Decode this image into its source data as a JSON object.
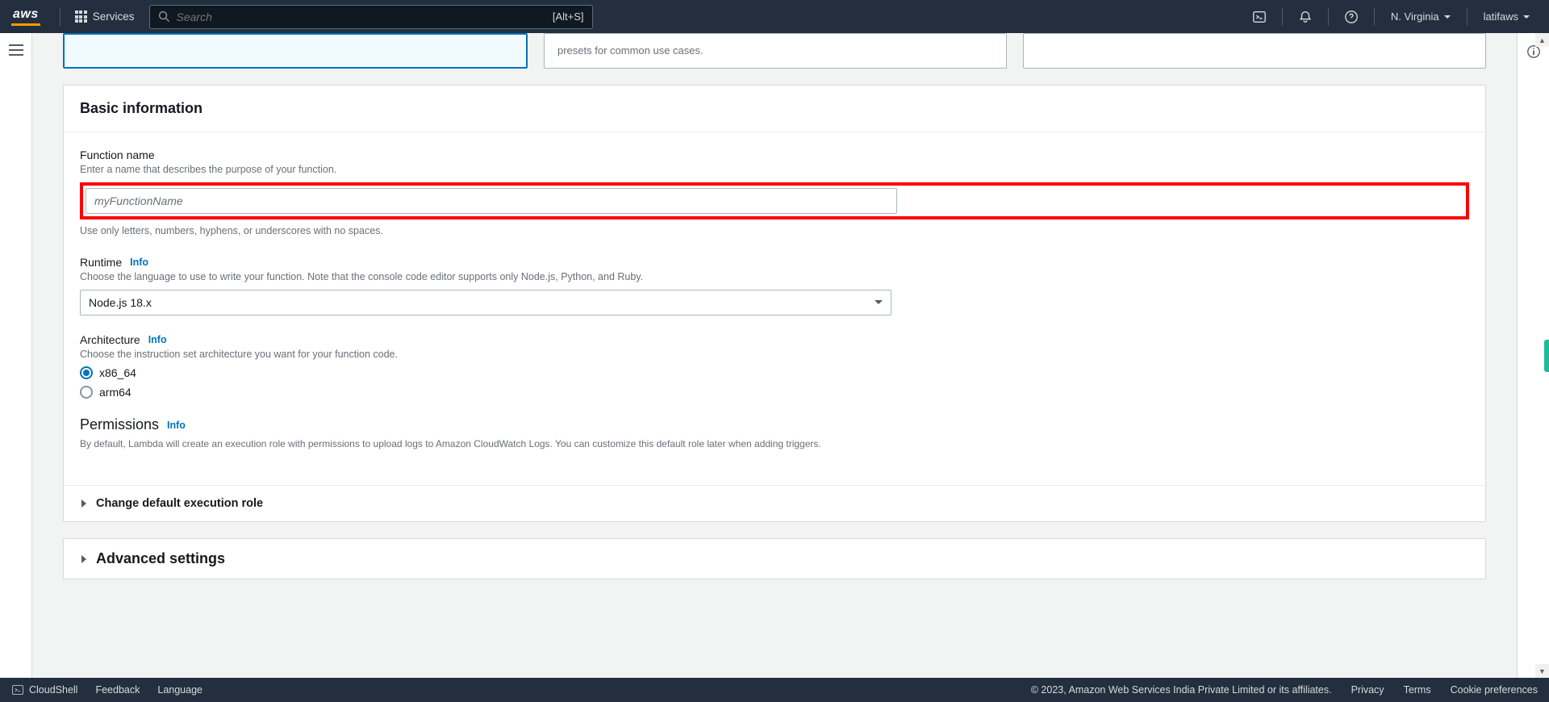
{
  "nav": {
    "logo": "aws",
    "services_label": "Services",
    "search_placeholder": "Search",
    "search_shortcut": "[Alt+S]",
    "region": "N. Virginia",
    "user": "latifaws"
  },
  "options": {
    "card1_partial": "",
    "card2_partial": "presets for common use cases.",
    "card3_partial": ""
  },
  "basic_info": {
    "heading": "Basic information",
    "function_name": {
      "label": "Function name",
      "hint": "Enter a name that describes the purpose of your function.",
      "placeholder": "myFunctionName",
      "constraint": "Use only letters, numbers, hyphens, or underscores with no spaces."
    },
    "runtime": {
      "label": "Runtime",
      "info": "Info",
      "hint": "Choose the language to use to write your function. Note that the console code editor supports only Node.js, Python, and Ruby.",
      "value": "Node.js 18.x"
    },
    "architecture": {
      "label": "Architecture",
      "info": "Info",
      "hint": "Choose the instruction set architecture you want for your function code.",
      "options": [
        "x86_64",
        "arm64"
      ]
    },
    "permissions": {
      "label": "Permissions",
      "info": "Info",
      "hint": "By default, Lambda will create an execution role with permissions to upload logs to Amazon CloudWatch Logs. You can customize this default role later when adding triggers."
    },
    "change_role": "Change default execution role"
  },
  "advanced": {
    "label": "Advanced settings"
  },
  "footer": {
    "cloudshell": "CloudShell",
    "feedback": "Feedback",
    "language": "Language",
    "copyright": "© 2023, Amazon Web Services India Private Limited or its affiliates.",
    "privacy": "Privacy",
    "terms": "Terms",
    "cookies": "Cookie preferences"
  }
}
